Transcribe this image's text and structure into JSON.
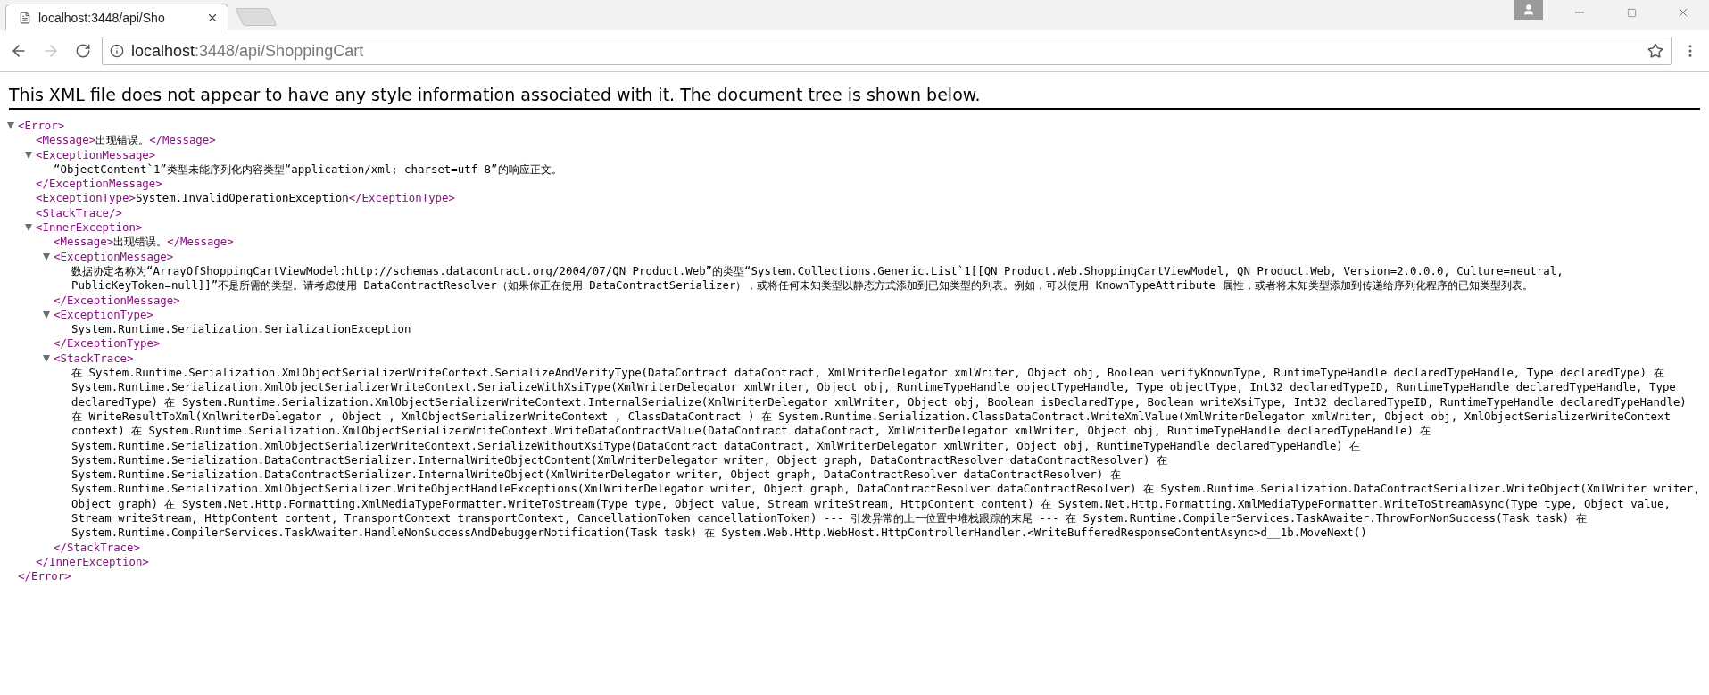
{
  "browser": {
    "tabs": [
      {
        "title": "localhost:3448/api/Sho",
        "selected": true
      }
    ],
    "address": {
      "host": "localhost",
      "path": ":3448/api/ShoppingCart"
    }
  },
  "notice": "This XML file does not appear to have any style information associated with it. The document tree is shown below.",
  "tree": {
    "kind": "block",
    "open": "<Error>",
    "close": "</Error>",
    "expanded": true,
    "children": [
      {
        "kind": "inline",
        "open": "<Message>",
        "text": "出现错误。",
        "close": "</Message>"
      },
      {
        "kind": "block",
        "open": "<ExceptionMessage>",
        "close": "</ExceptionMessage>",
        "expanded": true,
        "children": [
          {
            "kind": "text",
            "text": "“ObjectContent`1”类型未能序列化内容类型“application/xml; charset=utf-8”的响应正文。"
          }
        ]
      },
      {
        "kind": "inline",
        "open": "<ExceptionType>",
        "text": "System.InvalidOperationException",
        "close": "</ExceptionType>"
      },
      {
        "kind": "empty",
        "open": "<StackTrace/>"
      },
      {
        "kind": "block",
        "open": "<InnerException>",
        "close": "</InnerException>",
        "expanded": true,
        "children": [
          {
            "kind": "inline",
            "open": "<Message>",
            "text": "出现错误。",
            "close": "</Message>"
          },
          {
            "kind": "block",
            "open": "<ExceptionMessage>",
            "close": "</ExceptionMessage>",
            "expanded": true,
            "children": [
              {
                "kind": "text",
                "text": "数据协定名称为“ArrayOfShoppingCartViewModel:http://schemas.datacontract.org/2004/07/QN_Product.Web”的类型“System.Collections.Generic.List`1[[QN_Product.Web.ShoppingCartViewModel, QN_Product.Web, Version=2.0.0.0, Culture=neutral, PublicKeyToken=null]]”不是所需的类型。请考虑使用 DataContractResolver（如果你正在使用 DataContractSerializer），或将任何未知类型以静态方式添加到已知类型的列表。例如，可以使用 KnownTypeAttribute 属性，或者将未知类型添加到传递给序列化程序的已知类型列表。"
              }
            ]
          },
          {
            "kind": "block",
            "open": "<ExceptionType>",
            "close": "</ExceptionType>",
            "expanded": true,
            "children": [
              {
                "kind": "text",
                "text": "System.Runtime.Serialization.SerializationException"
              }
            ]
          },
          {
            "kind": "block",
            "open": "<StackTrace>",
            "close": "</StackTrace>",
            "expanded": true,
            "children": [
              {
                "kind": "text",
                "text": "在 System.Runtime.Serialization.XmlObjectSerializerWriteContext.SerializeAndVerifyType(DataContract dataContract, XmlWriterDelegator xmlWriter, Object obj, Boolean verifyKnownType, RuntimeTypeHandle declaredTypeHandle, Type declaredType) 在 System.Runtime.Serialization.XmlObjectSerializerWriteContext.SerializeWithXsiType(XmlWriterDelegator xmlWriter, Object obj, RuntimeTypeHandle objectTypeHandle, Type objectType, Int32 declaredTypeID, RuntimeTypeHandle declaredTypeHandle, Type declaredType) 在 System.Runtime.Serialization.XmlObjectSerializerWriteContext.InternalSerialize(XmlWriterDelegator xmlWriter, Object obj, Boolean isDeclaredType, Boolean writeXsiType, Int32 declaredTypeID, RuntimeTypeHandle declaredTypeHandle) 在 WriteResultToXml(XmlWriterDelegator , Object , XmlObjectSerializerWriteContext , ClassDataContract ) 在 System.Runtime.Serialization.ClassDataContract.WriteXmlValue(XmlWriterDelegator xmlWriter, Object obj, XmlObjectSerializerWriteContext context) 在 System.Runtime.Serialization.XmlObjectSerializerWriteContext.WriteDataContractValue(DataContract dataContract, XmlWriterDelegator xmlWriter, Object obj, RuntimeTypeHandle declaredTypeHandle) 在 System.Runtime.Serialization.XmlObjectSerializerWriteContext.SerializeWithoutXsiType(DataContract dataContract, XmlWriterDelegator xmlWriter, Object obj, RuntimeTypeHandle declaredTypeHandle) 在 System.Runtime.Serialization.DataContractSerializer.InternalWriteObjectContent(XmlWriterDelegator writer, Object graph, DataContractResolver dataContractResolver) 在 System.Runtime.Serialization.DataContractSerializer.InternalWriteObject(XmlWriterDelegator writer, Object graph, DataContractResolver dataContractResolver) 在 System.Runtime.Serialization.XmlObjectSerializer.WriteObjectHandleExceptions(XmlWriterDelegator writer, Object graph, DataContractResolver dataContractResolver) 在 System.Runtime.Serialization.DataContractSerializer.WriteObject(XmlWriter writer, Object graph) 在 System.Net.Http.Formatting.XmlMediaTypeFormatter.WriteToStream(Type type, Object value, Stream writeStream, HttpContent content) 在 System.Net.Http.Formatting.XmlMediaTypeFormatter.WriteToStreamAsync(Type type, Object value, Stream writeStream, HttpContent content, TransportContext transportContext, CancellationToken cancellationToken) --- 引发异常的上一位置中堆栈跟踪的末尾 --- 在 System.Runtime.CompilerServices.TaskAwaiter.ThrowForNonSuccess(Task task) 在 System.Runtime.CompilerServices.TaskAwaiter.HandleNonSuccessAndDebuggerNotification(Task task) 在 System.Web.Http.WebHost.HttpControllerHandler.<WriteBufferedResponseContentAsync>d__1b.MoveNext()"
              }
            ]
          }
        ]
      }
    ]
  }
}
